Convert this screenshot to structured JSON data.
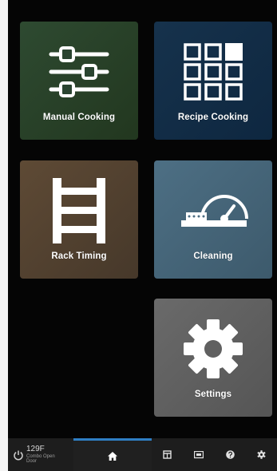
{
  "tiles": {
    "manual_cooking": {
      "label": "Manual Cooking",
      "icon": "sliders-icon",
      "color": "#2e4a31"
    },
    "recipe_cooking": {
      "label": "Recipe Cooking",
      "icon": "grid-icon",
      "color": "#16324c"
    },
    "rack_timing": {
      "label": "Rack Timing",
      "icon": "rack-icon",
      "color": "#5e4a35"
    },
    "cleaning": {
      "label": "Cleaning",
      "icon": "gauge-icon",
      "color": "#4d6f84"
    },
    "settings": {
      "label": "Settings",
      "icon": "gear-icon",
      "color": "#6a6a6a"
    }
  },
  "bottom_bar": {
    "temperature": "129F",
    "mode": "Combo Open Door",
    "active_color": "#2f7fc4",
    "buttons": [
      "power-icon",
      "home-icon",
      "recipe-book-icon",
      "screen-icon",
      "help-icon",
      "settings-icon"
    ]
  }
}
